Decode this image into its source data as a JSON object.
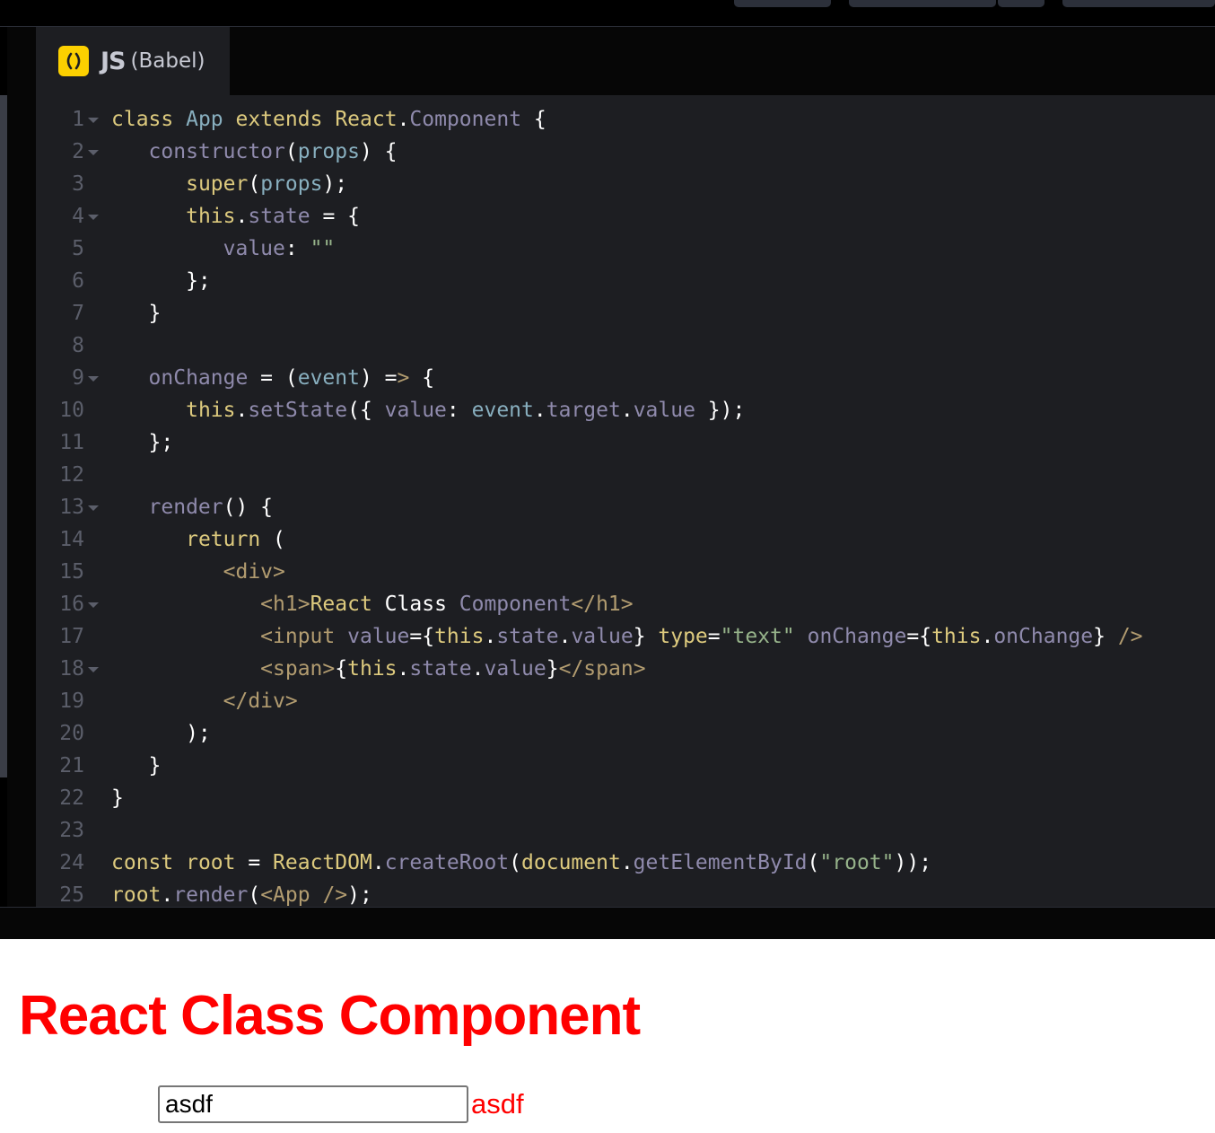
{
  "tab": {
    "icon": "babel-js-icon",
    "label": "JS",
    "sublabel": "(Babel)"
  },
  "colors": {
    "keyword": "#ddca7e",
    "class": "#88afbf",
    "property": "#a5a1c0",
    "string": "#96b38a",
    "tag": "#b29c70",
    "preview_text": "#ff0000"
  },
  "line_numbers": [
    "1",
    "2",
    "3",
    "4",
    "5",
    "6",
    "7",
    "8",
    "9",
    "10",
    "11",
    "12",
    "13",
    "14",
    "15",
    "16",
    "17",
    "18",
    "19",
    "20",
    "21",
    "22",
    "23",
    "24",
    "25"
  ],
  "code_lines": [
    "class App extends React.Component {",
    "   constructor(props) {",
    "      super(props);",
    "      this.state = {",
    "         value: \"\"",
    "      };",
    "   }",
    "",
    "   onChange = (event) => {",
    "      this.setState({ value: event.target.value });",
    "   };",
    "",
    "   render() {",
    "      return (",
    "         <div>",
    "            <h1>React Class Component</h1>",
    "            <input value={this.state.value} type=\"text\" onChange={this.onChange} />",
    "            <span>{this.state.value}</span>",
    "         </div>",
    "      );",
    "   }",
    "}",
    "",
    "const root = ReactDOM.createRoot(document.getElementById(\"root\"));",
    "root.render(<App />);"
  ],
  "preview": {
    "heading": "React Class Component",
    "input_value": "asdf",
    "echo": "asdf"
  }
}
